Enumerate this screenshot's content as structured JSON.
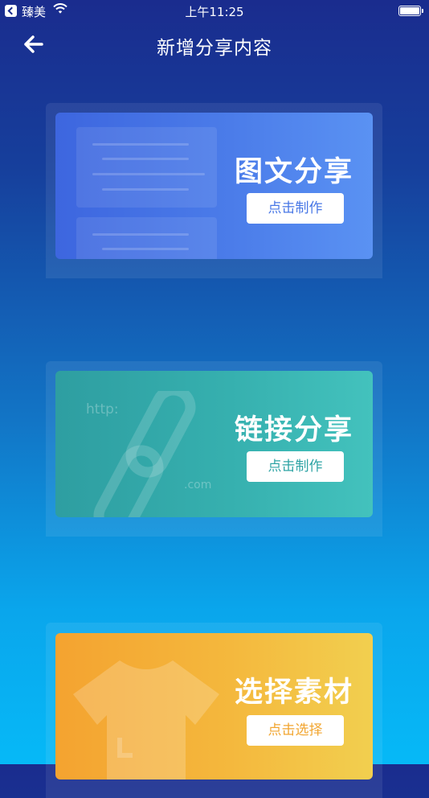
{
  "status_bar": {
    "app_name": "臻美",
    "time": "上午11:25"
  },
  "nav": {
    "title": "新增分享内容"
  },
  "cards": [
    {
      "title": "图文分享",
      "button_label": "点击制作"
    },
    {
      "title": "链接分享",
      "button_label": "点击制作",
      "deco_http": "http:",
      "deco_com": ".com"
    },
    {
      "title": "选择素材",
      "button_label": "点击选择"
    }
  ],
  "colors": {
    "background_top": "#1a2c8e",
    "background_bottom": "#06b9f7",
    "card_image_text": "#4b7ce9",
    "card_link": "#36b0af",
    "card_material": "#f4b83d"
  },
  "icons": [
    "back-arrow-icon",
    "wifi-icon",
    "battery-icon",
    "document-illustration",
    "chain-link-illustration",
    "tshirt-illustration"
  ]
}
